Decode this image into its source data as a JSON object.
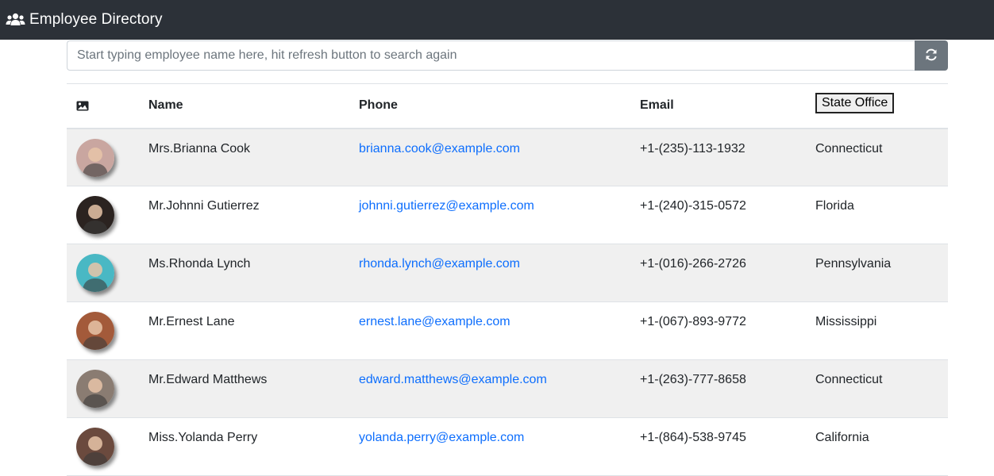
{
  "navbar": {
    "brand_icon": "users-icon",
    "title": "Employee Directory"
  },
  "search": {
    "placeholder": "Start typing employee name here, hit refresh button to search again",
    "value": "",
    "refresh_icon": "refresh-icon"
  },
  "table": {
    "headers": {
      "image_icon": "image-icon",
      "name": "Name",
      "phone": "Phone",
      "email": "Email",
      "state": "State Office"
    },
    "rows": [
      {
        "name": "Mrs.Brianna Cook",
        "email": "brianna.cook@example.com",
        "phone": "+1-(235)-113-1932",
        "state": "Connecticut",
        "avatar_color": "#c9a6a0"
      },
      {
        "name": "Mr.Johnni Gutierrez",
        "email": "johnni.gutierrez@example.com",
        "phone": "+1-(240)-315-0572",
        "state": "Florida",
        "avatar_color": "#2b2320"
      },
      {
        "name": "Ms.Rhonda Lynch",
        "email": "rhonda.lynch@example.com",
        "phone": "+1-(016)-266-2726",
        "state": "Pennsylvania",
        "avatar_color": "#49b8c4"
      },
      {
        "name": "Mr.Ernest Lane",
        "email": "ernest.lane@example.com",
        "phone": "+1-(067)-893-9772",
        "state": "Mississippi",
        "avatar_color": "#a35a3a"
      },
      {
        "name": "Mr.Edward Matthews",
        "email": "edward.matthews@example.com",
        "phone": "+1-(263)-777-8658",
        "state": "Connecticut",
        "avatar_color": "#8a7c72"
      },
      {
        "name": "Miss.Yolanda Perry",
        "email": "yolanda.perry@example.com",
        "phone": "+1-(864)-538-9745",
        "state": "California",
        "avatar_color": "#6b4a3e"
      }
    ]
  },
  "colors": {
    "navbar_bg": "#2c3138",
    "refresh_btn_bg": "#6c757d",
    "link": "#0d6efd",
    "row_stripe": "#f0f0f0"
  }
}
